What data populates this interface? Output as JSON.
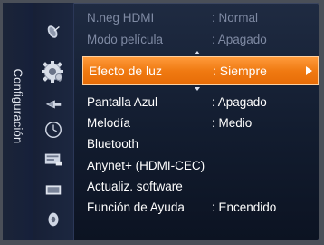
{
  "side_label": "Configuración",
  "icons": [
    "satellite-dish-icon",
    "settings-gear-icon",
    "input-arrow-icon",
    "clock-icon",
    "app-window-icon",
    "support-screen-icon",
    "cd-disc-icon"
  ],
  "menu": {
    "items": [
      {
        "name": "N.neg HDMI",
        "value": ": Normal",
        "state": "dim"
      },
      {
        "name": "Modo película",
        "value": ": Apagado",
        "state": "dim"
      },
      {
        "name": "Efecto de luz",
        "value": ": Siempre",
        "state": "selected"
      },
      {
        "name": "Pantalla Azul",
        "value": ": Apagado",
        "state": "normal"
      },
      {
        "name": "Melodía",
        "value": ": Medio",
        "state": "normal"
      },
      {
        "name": "Bluetooth",
        "value": "",
        "state": "normal"
      },
      {
        "name": "Anynet+ (HDMI-CEC)",
        "value": "",
        "state": "normal"
      },
      {
        "name": "Actualiz. software",
        "value": "",
        "state": "normal"
      },
      {
        "name": "Función de Ayuda",
        "value": ": Encendido",
        "state": "normal"
      }
    ]
  },
  "colors": {
    "highlight": "#f07a12",
    "background": "#121c2f",
    "dim_text": "#7f8aa3",
    "text": "#ffffff"
  }
}
